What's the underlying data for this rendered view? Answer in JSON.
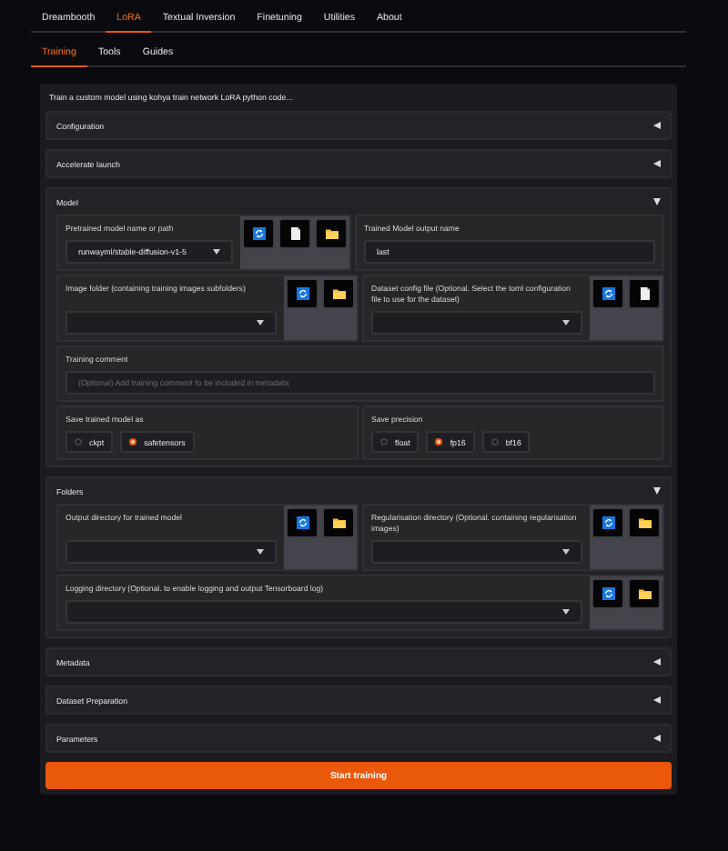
{
  "tabs": [
    {
      "label": "Dreambooth",
      "selected": false
    },
    {
      "label": "LoRA",
      "selected": true
    },
    {
      "label": "Textual Inversion",
      "selected": false
    },
    {
      "label": "Finetuning",
      "selected": false
    },
    {
      "label": "Utilities",
      "selected": false
    },
    {
      "label": "About",
      "selected": false
    }
  ],
  "subtabs": [
    {
      "label": "Training",
      "selected": true
    },
    {
      "label": "Tools",
      "selected": false
    },
    {
      "label": "Guides",
      "selected": false
    }
  ],
  "description": "Train a custom model using kohya train network LoRA python code...",
  "sections": [
    {
      "title": "Configuration",
      "expanded": false
    },
    {
      "title": "Accelerate launch",
      "expanded": false
    },
    {
      "title": "Model",
      "expanded": true,
      "rows": [
        {
          "cells": [
            {
              "kind": "dropdown",
              "label": "Pretrained model name or path",
              "value": "runwayml/stable-diffusion-v1-5",
              "buttons": [
                {
                  "kind": "refresh"
                },
                {
                  "kind": "file"
                },
                {
                  "kind": "folder"
                }
              ]
            },
            {
              "kind": "text",
              "label": "Trained Model output name",
              "value": "last"
            }
          ]
        },
        {
          "cells": [
            {
              "kind": "dropdown",
              "label": "Image folder (containing training images subfolders)",
              "buttons": [
                {
                  "kind": "refresh"
                },
                {
                  "kind": "folder"
                }
              ]
            },
            {
              "kind": "dropdown",
              "label": "Dataset config file (Optional. Select the toml configuration file to use for the dataset)",
              "buttons": [
                {
                  "kind": "refresh"
                },
                {
                  "kind": "file"
                }
              ]
            }
          ]
        },
        {
          "cells": [
            {
              "kind": "text",
              "label": "Training comment",
              "placeholder": "(Optional) Add training comment to be included in metadata"
            }
          ]
        },
        {
          "cells": [
            {
              "kind": "radio",
              "label": "Save trained model as",
              "options": [
                {
                  "label": "ckpt",
                  "selected": false
                },
                {
                  "label": "safetensors",
                  "selected": true
                }
              ]
            },
            {
              "kind": "radio",
              "label": "Save precision",
              "options": [
                {
                  "label": "float",
                  "selected": false
                },
                {
                  "label": "fp16",
                  "selected": true
                },
                {
                  "label": "bf16",
                  "selected": false
                }
              ]
            }
          ]
        }
      ]
    },
    {
      "title": "Folders",
      "expanded": true,
      "rows": [
        {
          "cells": [
            {
              "kind": "dropdown",
              "label": "Output directory for trained model",
              "buttons": [
                {
                  "kind": "refresh"
                },
                {
                  "kind": "folder"
                }
              ]
            },
            {
              "kind": "dropdown",
              "label": "Regularisation directory (Optional. containing regularisation images)",
              "buttons": [
                {
                  "kind": "refresh"
                },
                {
                  "kind": "folder"
                }
              ]
            }
          ]
        },
        {
          "cells": [
            {
              "kind": "dropdown",
              "label": "Logging directory (Optional. to enable logging and output Tensorboard log)",
              "buttons": [
                {
                  "kind": "refresh"
                },
                {
                  "kind": "folder"
                }
              ]
            }
          ]
        }
      ]
    },
    {
      "title": "Metadata",
      "expanded": false
    },
    {
      "title": "Dataset Preparation",
      "expanded": false
    },
    {
      "title": "Parameters",
      "expanded": false
    }
  ],
  "start_button": "Start training"
}
